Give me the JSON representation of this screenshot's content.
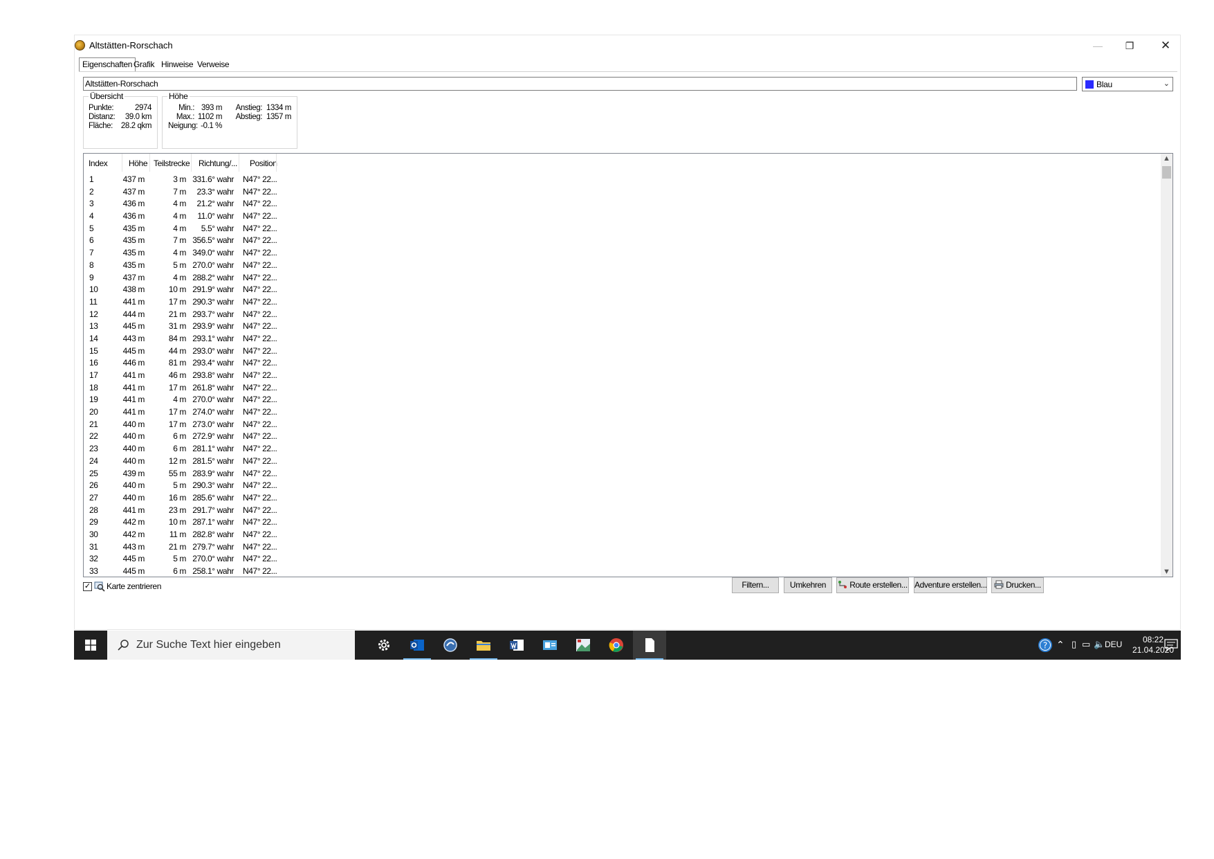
{
  "window": {
    "title": "Altstätten-Rorschach",
    "controls": {
      "minimize": "—",
      "maximize": "❐",
      "close": "✕"
    }
  },
  "tabs": [
    "Eigenschaften",
    "Grafik",
    "Hinweise",
    "Verweise"
  ],
  "active_tab": "Eigenschaften",
  "name_field": {
    "value": "Altstätten-Rorschach"
  },
  "color_select": {
    "label": "Blau",
    "color": "#2b2bff"
  },
  "overview": {
    "title": "Übersicht",
    "points_label": "Punkte:",
    "points_value": "2974",
    "distance_label": "Distanz:",
    "distance_value": "39.0 km",
    "area_label": "Fläche:",
    "area_value": "28.2 qkm"
  },
  "elevation": {
    "title": "Höhe",
    "min_label": "Min.:",
    "min_value": "393 m",
    "max_label": "Max.:",
    "max_value": "1102 m",
    "slope_label": "Neigung:",
    "slope_value": "-0.1 %",
    "ascent_label": "Anstieg:",
    "ascent_value": "1334 m",
    "descent_label": "Abstieg:",
    "descent_value": "1357 m"
  },
  "table": {
    "columns": [
      "Index",
      "Höhe",
      "Teilstrecke",
      "Richtung/...",
      "Position"
    ],
    "rows": [
      [
        "1",
        "437 m",
        "3 m",
        "331.6° wahr",
        "N47° 22..."
      ],
      [
        "2",
        "437 m",
        "7 m",
        "23.3° wahr",
        "N47° 22..."
      ],
      [
        "3",
        "436 m",
        "4 m",
        "21.2° wahr",
        "N47° 22..."
      ],
      [
        "4",
        "436 m",
        "4 m",
        "11.0° wahr",
        "N47° 22..."
      ],
      [
        "5",
        "435 m",
        "4 m",
        "5.5° wahr",
        "N47° 22..."
      ],
      [
        "6",
        "435 m",
        "7 m",
        "356.5° wahr",
        "N47° 22..."
      ],
      [
        "7",
        "435 m",
        "4 m",
        "349.0° wahr",
        "N47° 22..."
      ],
      [
        "8",
        "435 m",
        "5 m",
        "270.0° wahr",
        "N47° 22..."
      ],
      [
        "9",
        "437 m",
        "4 m",
        "288.2° wahr",
        "N47° 22..."
      ],
      [
        "10",
        "438 m",
        "10 m",
        "291.9° wahr",
        "N47° 22..."
      ],
      [
        "11",
        "441 m",
        "17 m",
        "290.3° wahr",
        "N47° 22..."
      ],
      [
        "12",
        "444 m",
        "21 m",
        "293.7° wahr",
        "N47° 22..."
      ],
      [
        "13",
        "445 m",
        "31 m",
        "293.9° wahr",
        "N47° 22..."
      ],
      [
        "14",
        "443 m",
        "84 m",
        "293.1° wahr",
        "N47° 22..."
      ],
      [
        "15",
        "445 m",
        "44 m",
        "293.0° wahr",
        "N47° 22..."
      ],
      [
        "16",
        "446 m",
        "81 m",
        "293.4° wahr",
        "N47° 22..."
      ],
      [
        "17",
        "441 m",
        "46 m",
        "293.8° wahr",
        "N47° 22..."
      ],
      [
        "18",
        "441 m",
        "17 m",
        "261.8° wahr",
        "N47° 22..."
      ],
      [
        "19",
        "441 m",
        "4 m",
        "270.0° wahr",
        "N47° 22..."
      ],
      [
        "20",
        "441 m",
        "17 m",
        "274.0° wahr",
        "N47° 22..."
      ],
      [
        "21",
        "440 m",
        "17 m",
        "273.0° wahr",
        "N47° 22..."
      ],
      [
        "22",
        "440 m",
        "6 m",
        "272.9° wahr",
        "N47° 22..."
      ],
      [
        "23",
        "440 m",
        "6 m",
        "281.1° wahr",
        "N47° 22..."
      ],
      [
        "24",
        "440 m",
        "12 m",
        "281.5° wahr",
        "N47° 22..."
      ],
      [
        "25",
        "439 m",
        "55 m",
        "283.9° wahr",
        "N47° 22..."
      ],
      [
        "26",
        "440 m",
        "5 m",
        "290.3° wahr",
        "N47° 22..."
      ],
      [
        "27",
        "440 m",
        "16 m",
        "285.6° wahr",
        "N47° 22..."
      ],
      [
        "28",
        "441 m",
        "23 m",
        "291.7° wahr",
        "N47° 22..."
      ],
      [
        "29",
        "442 m",
        "10 m",
        "287.1° wahr",
        "N47° 22..."
      ],
      [
        "30",
        "442 m",
        "11 m",
        "282.8° wahr",
        "N47° 22..."
      ],
      [
        "31",
        "443 m",
        "21 m",
        "279.7° wahr",
        "N47° 22..."
      ],
      [
        "32",
        "445 m",
        "5 m",
        "270.0° wahr",
        "N47° 22..."
      ],
      [
        "33",
        "445 m",
        "6 m",
        "258.1° wahr",
        "N47° 22..."
      ]
    ]
  },
  "center_map": {
    "label": "Karte zentrieren",
    "checked": true
  },
  "buttons": {
    "filter": "Filtern...",
    "reverse": "Umkehren",
    "create_route": "Route erstellen...",
    "create_adventure": "Adventure erstellen...",
    "print": "Drucken..."
  },
  "taskbar": {
    "search_placeholder": "Zur Suche Text hier eingeben",
    "apps": [
      "settings-icon",
      "outlook-icon",
      "browser-icon",
      "file-explorer-icon",
      "word-icon",
      "mail-icon",
      "photos-icon",
      "chrome-icon",
      "document-icon"
    ],
    "language": "DEU",
    "time": "08:22",
    "date": "21.04.2020"
  }
}
